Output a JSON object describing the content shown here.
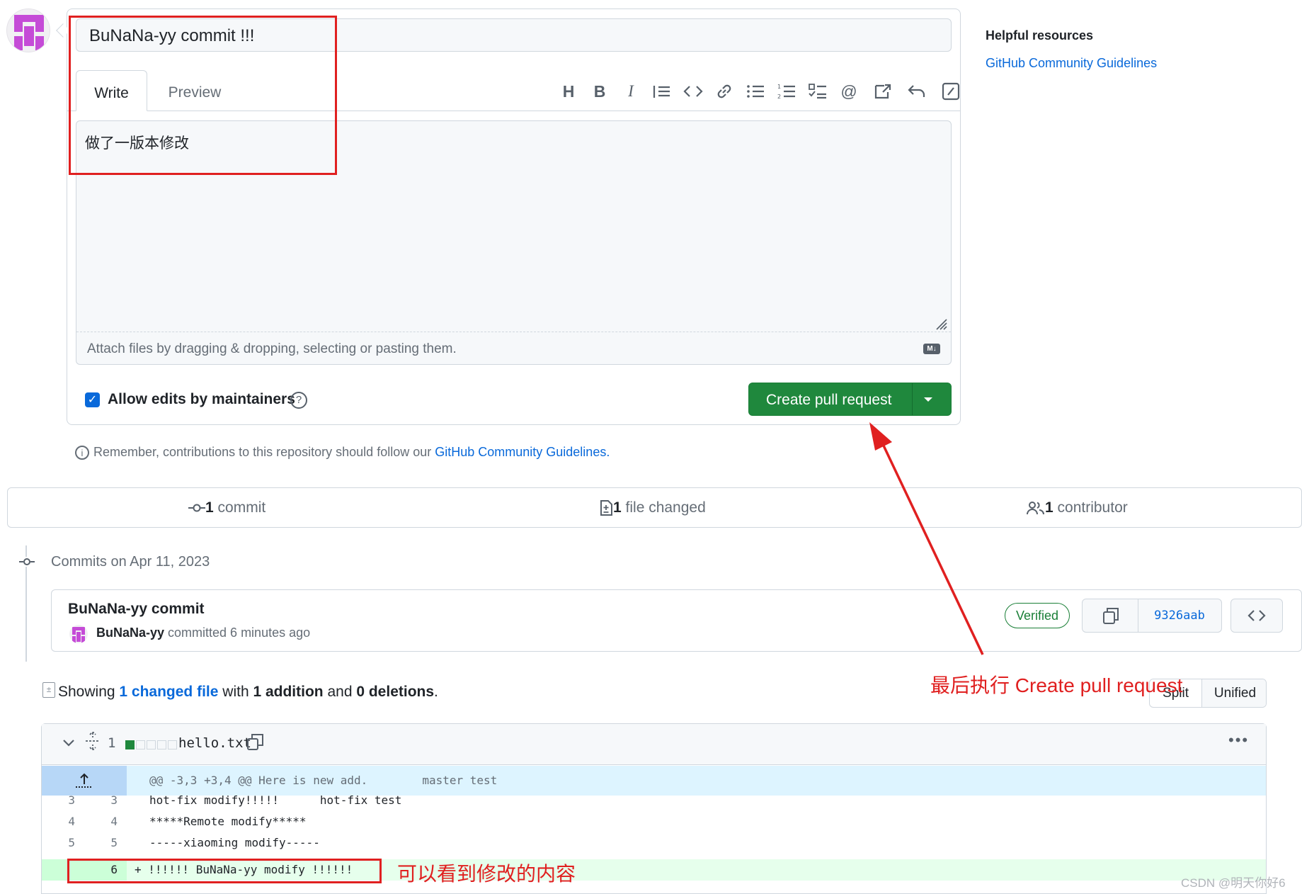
{
  "compose": {
    "title_value": "BuNaNa-yy commit !!!",
    "tabs": {
      "write": "Write",
      "preview": "Preview"
    },
    "toolbar": [
      "heading-icon",
      "bold-icon",
      "italic-icon",
      "quote-icon",
      "code-icon",
      "link-icon",
      "unordered-list-icon",
      "ordered-list-icon",
      "task-list-icon",
      "mention-icon",
      "reference-icon",
      "undo-icon",
      "slash-command-icon"
    ],
    "body_text": "做了一版本修改",
    "attach_text": "Attach files by dragging & dropping, selecting or pasting them.",
    "md_badge": "M↓",
    "allow_edits_label": "Allow edits by maintainers",
    "allow_edits_checked": true,
    "create_button": "Create pull request"
  },
  "remember": {
    "prefix": "Remember, contributions to this repository should follow our ",
    "link": "GitHub Community Guidelines",
    "suffix": "."
  },
  "sidebar": {
    "title": "Helpful resources",
    "link": "GitHub Community Guidelines"
  },
  "stats": {
    "commits_count": "1",
    "commits_label": " commit",
    "files_count": "1",
    "files_label": " file changed",
    "contributors_count": "1",
    "contributors_label": " contributor"
  },
  "commits": {
    "date_header": "Commits on Apr 11, 2023",
    "items": [
      {
        "title": "BuNaNa-yy commit",
        "author": "BuNaNa-yy",
        "meta": " committed 6 minutes ago",
        "badge": "Verified",
        "sha": "9326aab"
      }
    ]
  },
  "summary": {
    "prefix": "Showing ",
    "link": "1 changed file",
    "mid": " with ",
    "additions": "1 addition",
    "and": " and ",
    "deletions": "0 deletions",
    "suffix": "."
  },
  "view_toggle": {
    "split": "Split",
    "unified": "Unified"
  },
  "diff": {
    "change_count": "1",
    "filename": "hello.txt",
    "hunk_header": "@@ -3,3 +3,4 @@ Here is new add.        master test",
    "lines": [
      {
        "old": "3",
        "new": "3",
        "text": "hot-fix modify!!!!!      hot-fix test"
      },
      {
        "old": "4",
        "new": "4",
        "text": "*****Remote modify*****"
      },
      {
        "old": "5",
        "new": "5",
        "text": "-----xiaoming modify-----"
      },
      {
        "old": "",
        "new": "6",
        "text": "+ !!!!!! BuNaNa-yy modify !!!!!!"
      }
    ]
  },
  "annotations": {
    "create_hint": "最后执行 Create pull request",
    "diff_hint": "可以看到修改的内容"
  },
  "watermark": "CSDN @明天你好6",
  "colors": {
    "primary_button": "#1f883d",
    "link": "#0969da",
    "annotation": "#e02020"
  }
}
